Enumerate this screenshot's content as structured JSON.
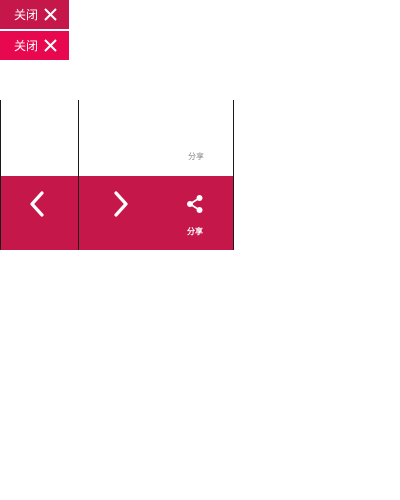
{
  "close_badges": [
    {
      "label": "关闭"
    },
    {
      "label": "关闭"
    }
  ],
  "widget": {
    "share_caption": "分享",
    "share_label": "分享",
    "prev_icon": "chevron-left-icon",
    "next_icon": "chevron-right-icon",
    "share_icon": "share-icon"
  },
  "colors": {
    "badge_primary": "#c6174a",
    "badge_active": "#e8084f",
    "bar": "#c6174a",
    "caption_gray": "#888888"
  }
}
